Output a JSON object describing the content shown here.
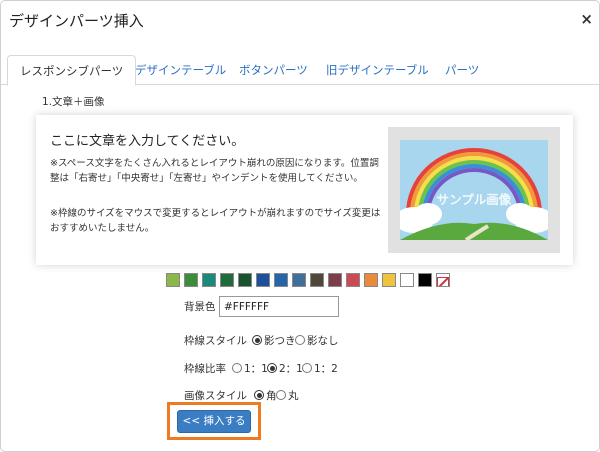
{
  "dialog": {
    "title": "デザインパーツ挿入",
    "close_symbol": "×"
  },
  "tabs": [
    {
      "label": "レスポンシブパーツ",
      "active": true
    },
    {
      "label": "デザインテーブル",
      "active": false
    },
    {
      "label": "ボタンパーツ",
      "active": false
    },
    {
      "label": "旧デザインテーブル",
      "active": false
    },
    {
      "label": "パーツ",
      "active": false
    }
  ],
  "section": {
    "label": "1.文章＋画像"
  },
  "preview": {
    "heading": "ここに文章を入力してください。",
    "note1": "※スペース文字をたくさん入れるとレイアウト崩れの原因になります。位置調整は「右寄せ」「中央寄せ」「左寄せ」やインデントを使用してください。",
    "note2": "※枠線のサイズをマウスで変更するとレイアウトが崩れますのでサイズ変更はおすすめいたしません。",
    "image_text": "サンプル画像"
  },
  "swatches": [
    "#8cb84a",
    "#3d8c3a",
    "#1b8a7a",
    "#1f6b3b",
    "#18532e",
    "#1c4f9c",
    "#2464a8",
    "#3f6f9a",
    "#514739",
    "#7d3e4a",
    "#cc4956",
    "#e98a3c",
    "#f0c43e",
    "#ffffff",
    "#000000",
    "none-slash"
  ],
  "form": {
    "bg_label": "背景色",
    "bg_value": "#FFFFFF",
    "border_style_label": "枠線スタイル",
    "border_style_options": [
      "影つき",
      "影なし"
    ],
    "border_ratio_label": "枠線比率",
    "border_ratio_options": [
      "1：1",
      "2：1",
      "1：2"
    ],
    "image_style_label": "画像スタイル",
    "image_style_options": [
      "角",
      "丸"
    ],
    "insert_label": "<< 挿入する"
  },
  "colors": {
    "link": "#2a6fc4",
    "button": "#3b7dc3",
    "highlight": "#ee7b22"
  }
}
